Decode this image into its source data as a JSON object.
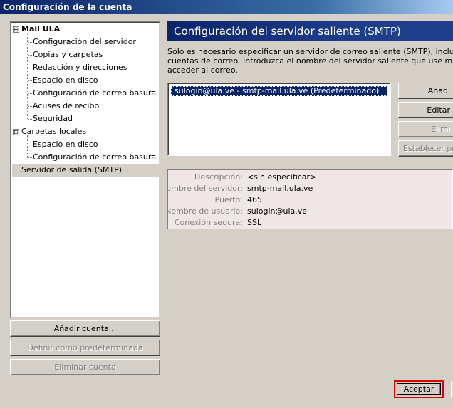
{
  "window": {
    "title": "Configuración de la cuenta"
  },
  "tree": {
    "accounts": [
      {
        "label": "Mail ULA",
        "expander": "⊟",
        "children": [
          "Configuración del servidor",
          "Copias y carpetas",
          "Redacción y direcciones",
          "Espacio en disco",
          "Configuración de correo basura",
          "Acuses de recibo",
          "Seguridad"
        ]
      },
      {
        "label": "Carpetas locales",
        "expander": "⊟",
        "children": [
          "Espacio en disco",
          "Configuración de correo basura"
        ]
      }
    ],
    "smtp_item": "Servidor de salida (SMTP)"
  },
  "left_buttons": {
    "add_account": "Añadir cuenta...",
    "set_default": "Definir como predeterminada",
    "remove_account": "Eliminar cuenta"
  },
  "panel": {
    "title": "Configuración del servidor saliente (SMTP)",
    "description": [
      "Sólo es necesario especificar un servidor de correo saliente (SMTP), incluso si tiene v",
      "cuentas de correo. Introduzca el nombre del servidor saliente que use más frecuent",
      "acceder al correo."
    ],
    "servers": [
      "sulogin@ula.ve - smtp-mail.ula.ve (Predeterminado)"
    ],
    "buttons": {
      "add": "Añadi",
      "edit": "Editar",
      "remove": "Elimi",
      "set_default": "Establecer pred"
    },
    "details": [
      {
        "label": "Descripción:",
        "value": "<sin especificar>"
      },
      {
        "label": "Nombre del servidor:",
        "value": "smtp-mail.ula.ve"
      },
      {
        "label": "Puerto:",
        "value": "465"
      },
      {
        "label": "Nombre de usuario:",
        "value": "sulogin@ula.ve"
      },
      {
        "label": "Conexión segura:",
        "value": "SSL"
      }
    ]
  },
  "footer": {
    "accept": "Aceptar"
  },
  "colors": {
    "titlebar": "#0a246a",
    "selection": "#0a246a",
    "details_bg": "#f0e6e6",
    "highlight_border": "#e00000"
  }
}
